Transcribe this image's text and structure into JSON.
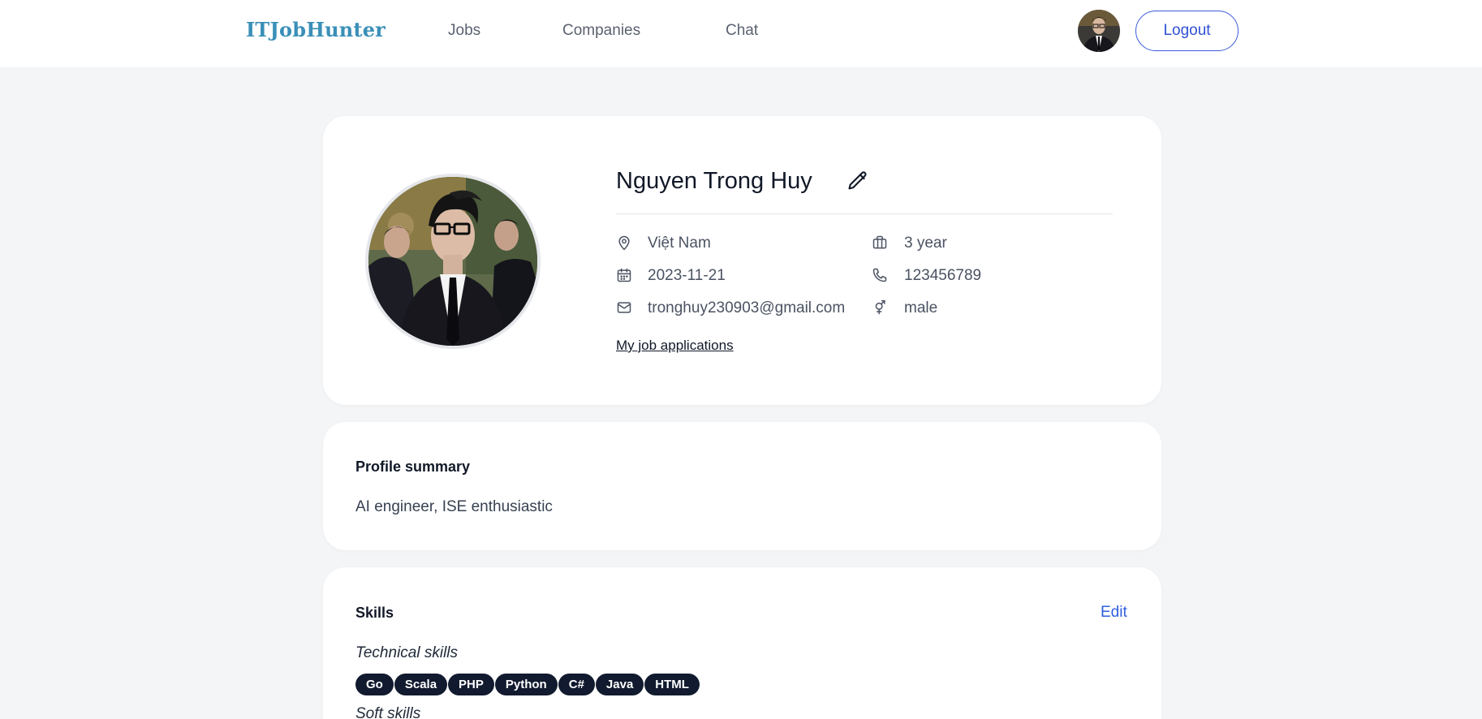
{
  "nav": {
    "brand": "ITJobHunter",
    "links": [
      "Jobs",
      "Companies",
      "Chat"
    ],
    "logout_label": "Logout"
  },
  "profile": {
    "name": "Nguyen Trong Huy",
    "location": "Việt Nam",
    "experience": "3 year",
    "birthdate": "2023-11-21",
    "phone": "123456789",
    "email": "tronghuy230903@gmail.com",
    "gender": "male",
    "job_applications_link": "My job applications"
  },
  "summary": {
    "title": "Profile summary",
    "text": "AI engineer, ISE enthusiastic"
  },
  "skills": {
    "title": "Skills",
    "edit_label": "Edit",
    "technical_label": "Technical skills",
    "technical": [
      "Go",
      "Scala",
      "PHP",
      "Python",
      "C#",
      "Java",
      "HTML"
    ],
    "soft_label": "Soft skills"
  },
  "colors": {
    "brand": "#3a8fb7",
    "accent": "#2f4fd4",
    "tag_bg": "#111a2e",
    "page_bg": "#f4f5f7"
  }
}
